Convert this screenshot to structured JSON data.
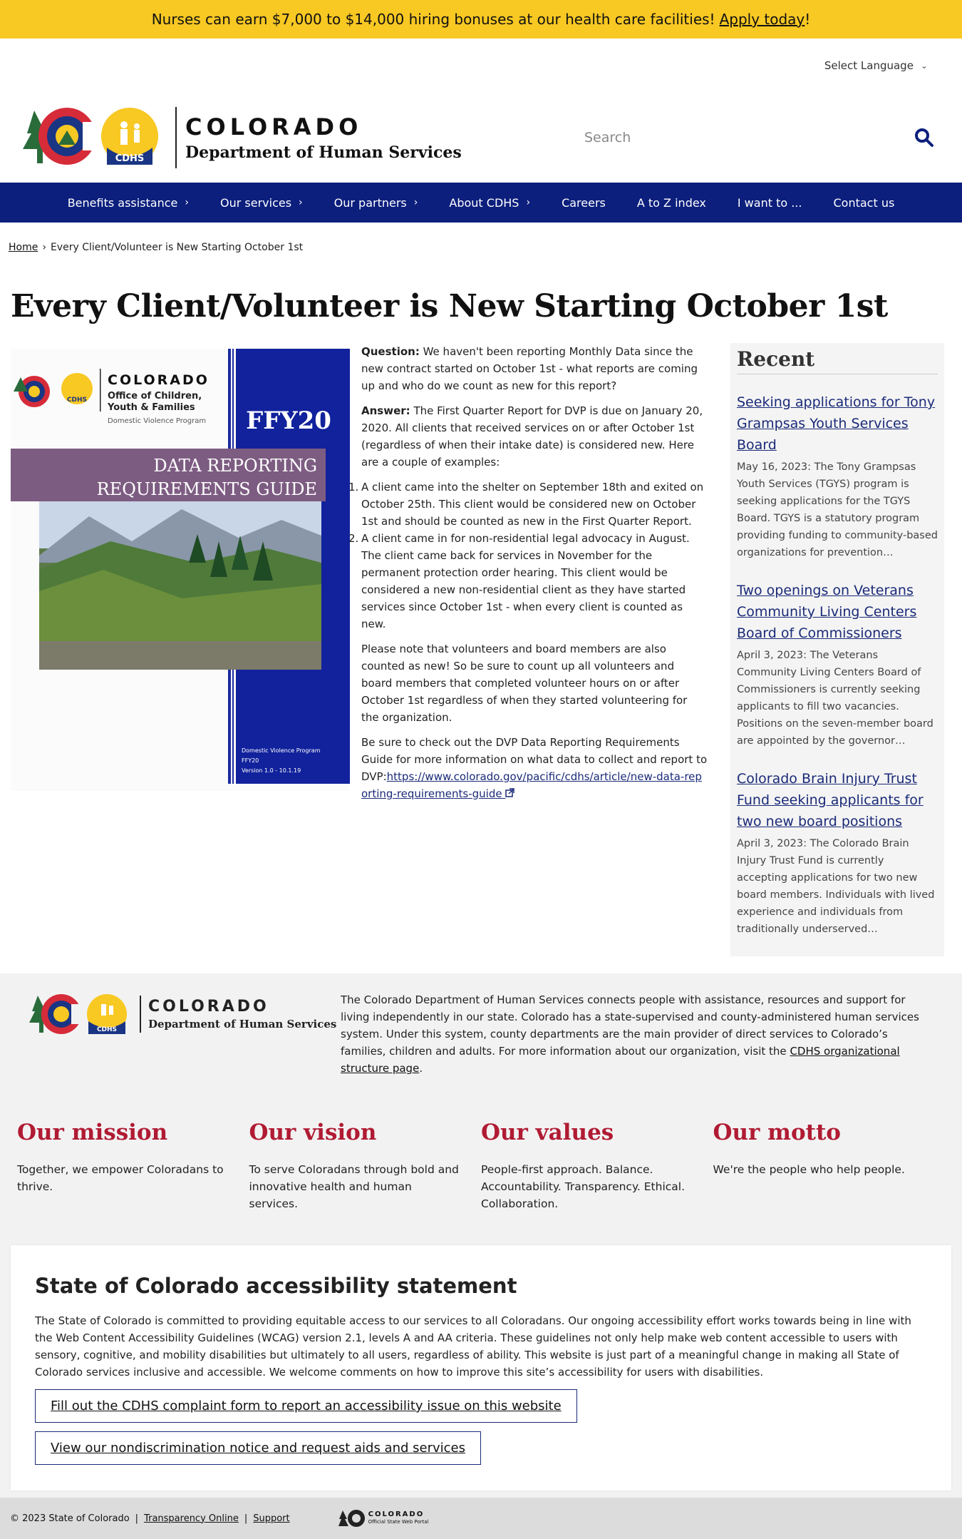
{
  "banner": {
    "text": "Nurses can earn $7,000 to $14,000 hiring bonuses at our health care facilities!",
    "link": "Apply today",
    "suffix": "!"
  },
  "language": {
    "label": "Select Language"
  },
  "header": {
    "colorado": "COLORADO",
    "dept": "Department of Human Services",
    "badge": "CDHS"
  },
  "search": {
    "placeholder": "Search"
  },
  "nav": {
    "items": [
      {
        "label": "Benefits assistance",
        "chevron": true
      },
      {
        "label": "Our services",
        "chevron": true
      },
      {
        "label": "Our partners",
        "chevron": true
      },
      {
        "label": "About CDHS",
        "chevron": true
      },
      {
        "label": "Careers",
        "chevron": false
      },
      {
        "label": "A to Z index",
        "chevron": false
      },
      {
        "label": "I want to ...",
        "chevron": false
      },
      {
        "label": "Contact us",
        "chevron": false
      }
    ]
  },
  "breadcrumb": {
    "home": "Home",
    "current": "Every Client/Volunteer is New Starting October 1st"
  },
  "page": {
    "title": "Every Client/Volunteer is New Starting October 1st"
  },
  "figure": {
    "colorado": "COLORADO",
    "org1": "Office of Children,",
    "org2": "Youth & Families",
    "program": "Domestic Violence Program",
    "badge": "CDHS",
    "ffy": "FFY20",
    "guide1": "DATA REPORTING",
    "guide2": "REQUIREMENTS GUIDE",
    "foot1": "Domestic Violence Program",
    "foot2": "FFY20",
    "foot3": "Version 1.0 - 10.1.19"
  },
  "article": {
    "q_label": "Question:",
    "q_text": "We haven't been reporting Monthly Data since the new contract started on October 1st - what reports are coming up and who do we count as new for this report?",
    "a_label": "Answer:",
    "a_text": "The First Quarter Report for DVP is due on January 20, 2020. All clients that received services on or after October 1st (regardless of when their intake date) is considered new. Here are a couple of examples:",
    "list": [
      {
        "num": "1.",
        "text": "A client came into the shelter on September 18th and exited on October 25th. This client would be considered new on October 1st and should be counted as new in the First Quarter Report."
      },
      {
        "num": "2.",
        "text": "A client came in for non-residential legal advocacy in August. The client came back for services in November for the permanent protection order hearing. This client would be considered a new non-residential client as they have started services since October 1st - when every client is counted as new."
      }
    ],
    "note": "Please note that volunteers and board members are also counted as new! So be sure to count up all volunteers and board members that completed volunteer hours on or after October 1st regardless of when they started volunteering for the organization.",
    "guide_text": "Be sure to check out the DVP Data Reporting Requirements Guide for more information on what data to collect and report to DVP:",
    "guide_link": "https://www.colorado.gov/pacific/cdhs/article/new-data-reporting-requirements-guide"
  },
  "sidebar": {
    "heading": "Recent",
    "items": [
      {
        "title": "Seeking applications for Tony Grampsas Youth Services Board",
        "summary": "May 16, 2023: The Tony Grampsas Youth Services (TGYS) program is seeking applications for the TGYS Board. TGYS is a statutory program providing funding to community-based organizations for prevention…"
      },
      {
        "title": "Two openings on Veterans Community Living Centers Board of  Commissioners ",
        "summary": "April 3, 2023: The Veterans Community Living Centers Board of Commissioners is currently seeking applicants to fill two vacancies. Positions on the seven-member board are appointed by the governor…"
      },
      {
        "title": "Colorado Brain Injury Trust Fund seeking applicants for two new board positions",
        "summary": "April 3, 2023: The Colorado Brain Injury Trust Fund is currently accepting applications for two new board members. Individuals with lived experience and individuals from traditionally underserved…"
      }
    ]
  },
  "footer": {
    "colorado": "COLORADO",
    "dept": "Department of Human Services",
    "badge": "CDHS",
    "desc": "The Colorado Department of Human Services connects people with assistance, resources and support for living independently in our state. Colorado has a state-supervised and county-administered human services system. Under this system, county departments are the main provider of direct services to Colorado’s families, children and adults. For more information about our organization, visit the",
    "desc_link": "CDHS organizational structure page",
    "desc_end": ".",
    "values": [
      {
        "heading": "Our mission",
        "text": "Together, we empower Coloradans to thrive."
      },
      {
        "heading": "Our vision",
        "text": "To serve Coloradans through bold and innovative health and human services."
      },
      {
        "heading": "Our values",
        "text": "People-first approach. Balance. Accountability. Transparency. Ethical. Collaboration."
      },
      {
        "heading": "Our motto",
        "text": "We're the people who help people."
      }
    ]
  },
  "accessibility": {
    "heading": "State of Colorado accessibility statement",
    "text": "The State of Colorado is committed to providing equitable access to our services to all Coloradans. Our ongoing accessibility effort works towards being in line with the Web Content Accessibility Guidelines (WCAG) version 2.1, levels A and AA criteria. These guidelines not only help make web content accessible to users with sensory, cognitive, and mobility disabilities but ultimately to all users, regardless of ability. This website is just part of a meaningful change in making all State of Colorado services inclusive and accessible. We welcome comments on how to improve this site’s accessibility for users with disabilities.",
    "btn1": "Fill out the CDHS complaint form to report an accessibility issue on this website",
    "btn2": "View our nondiscrimination notice and request aids and services"
  },
  "bottom": {
    "copyright": "© 2023 State of Colorado",
    "link1": "Transparency Online",
    "link2": "Support",
    "portal1": "COLORADO",
    "portal2": "Official State Web Portal"
  },
  "colors": {
    "banner": "#f8c823",
    "nav": "#0c1f7d",
    "link": "#1a2a78",
    "accent_red": "#b01b33"
  }
}
